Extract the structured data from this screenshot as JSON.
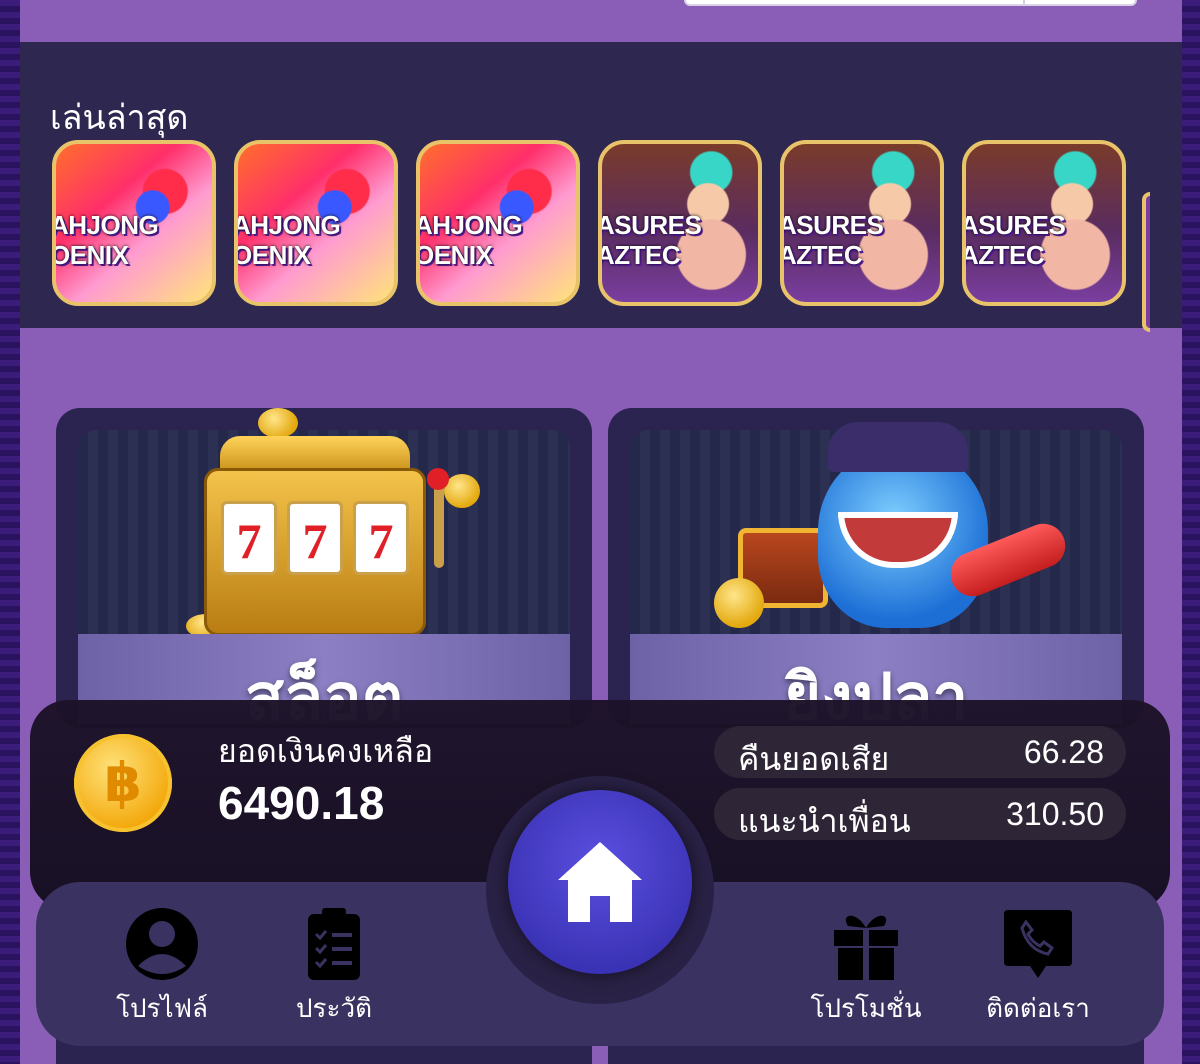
{
  "recent": {
    "title": "เล่นล่าสุด",
    "games": [
      {
        "label": "AHJONG\nOENIX",
        "theme": "phoenix"
      },
      {
        "label": "AHJONG\nOENIX",
        "theme": "phoenix"
      },
      {
        "label": "AHJONG\nOENIX",
        "theme": "phoenix"
      },
      {
        "label": "ASURES\nAZTEC",
        "theme": "aztec"
      },
      {
        "label": "ASURES\nAZTEC",
        "theme": "aztec"
      },
      {
        "label": "ASURES\nAZTEC",
        "theme": "aztec"
      }
    ]
  },
  "categories": {
    "slot": {
      "title": "สล็อต",
      "reels": [
        "7",
        "7",
        "7"
      ]
    },
    "fishing": {
      "title": "ยิงปลา"
    }
  },
  "wallet": {
    "balance_label": "ยอดเงินคงเหลือ",
    "balance_value": "6490.18",
    "coin_symbol": "฿",
    "cashback_label": "คืนยอดเสีย",
    "cashback_value": "66.28",
    "referral_label": "แนะนำเพื่อน",
    "referral_value": "310.50"
  },
  "nav": {
    "profile": "โปรไฟล์",
    "history": "ประวัติ",
    "promotion": "โปรโมชั่น",
    "contact": "ติดต่อเรา"
  },
  "colors": {
    "page_bg": "#8a5eb7",
    "panel_bg": "#2e2750",
    "thumb_border": "#e9c36a",
    "home_button": "#4a40cc"
  }
}
